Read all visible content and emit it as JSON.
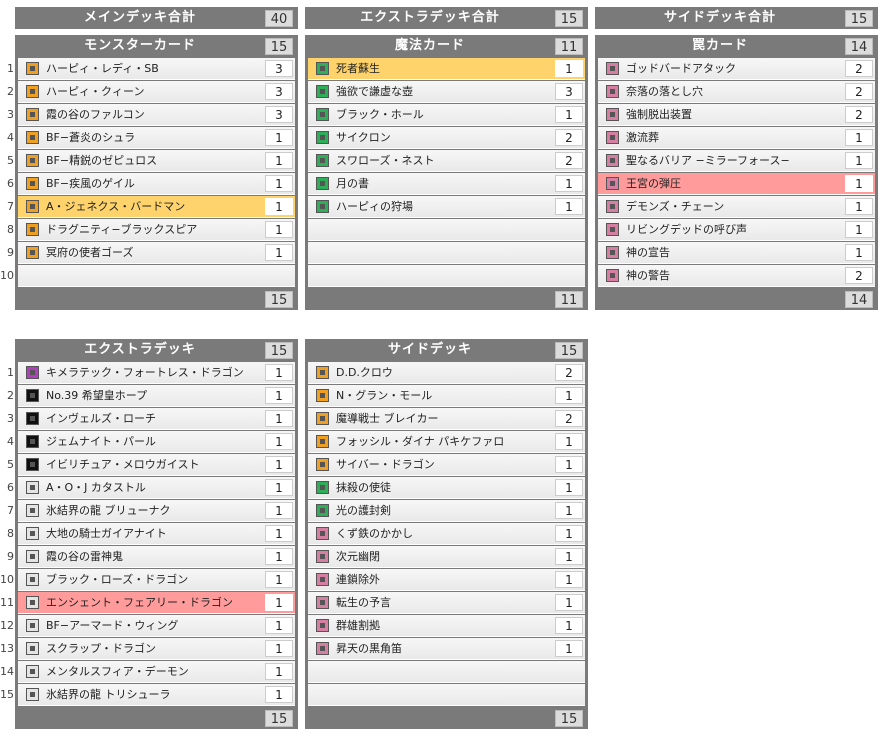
{
  "summary": [
    {
      "title": "メインデッキ合計",
      "count": "40"
    },
    {
      "title": "エクストラデッキ合計",
      "count": "15"
    },
    {
      "title": "サイドデッキ合計",
      "count": "15"
    }
  ],
  "panels": [
    {
      "id": "monster",
      "title": "モンスターカード",
      "count": "15",
      "footer": "15",
      "rownums": true,
      "rows": [
        {
          "num": "1",
          "name": "ハーピィ・レディ・SB",
          "qty": "3",
          "icon": "orange"
        },
        {
          "num": "2",
          "name": "ハーピィ・クィーン",
          "qty": "3",
          "icon": "orange"
        },
        {
          "num": "3",
          "name": "霞の谷のファルコン",
          "qty": "3",
          "icon": "orange"
        },
        {
          "num": "4",
          "name": "BF−蒼炎のシュラ",
          "qty": "1",
          "icon": "orange"
        },
        {
          "num": "5",
          "name": "BF−精鋭のゼピュロス",
          "qty": "1",
          "icon": "orange"
        },
        {
          "num": "6",
          "name": "BF−疾風のゲイル",
          "qty": "1",
          "icon": "orange"
        },
        {
          "num": "7",
          "name": "A・ジェネクス・バードマン",
          "qty": "1",
          "icon": "orange",
          "hl": "yellow"
        },
        {
          "num": "8",
          "name": "ドラグニティ−ブラックスピア",
          "qty": "1",
          "icon": "orange"
        },
        {
          "num": "9",
          "name": "冥府の使者ゴーズ",
          "qty": "1",
          "icon": "orange"
        },
        {
          "num": "10",
          "name": "",
          "qty": "",
          "icon": ""
        }
      ]
    },
    {
      "id": "spell",
      "title": "魔法カード",
      "count": "11",
      "footer": "11",
      "rownums": false,
      "rows": [
        {
          "name": "死者蘇生",
          "qty": "1",
          "icon": "green",
          "hl": "yellow"
        },
        {
          "name": "強欲で謙虚な壺",
          "qty": "3",
          "icon": "green"
        },
        {
          "name": "ブラック・ホール",
          "qty": "1",
          "icon": "green"
        },
        {
          "name": "サイクロン",
          "qty": "2",
          "icon": "green"
        },
        {
          "name": "スワローズ・ネスト",
          "qty": "2",
          "icon": "green"
        },
        {
          "name": "月の書",
          "qty": "1",
          "icon": "green"
        },
        {
          "name": "ハーピィの狩場",
          "qty": "1",
          "icon": "green"
        },
        {
          "name": "",
          "qty": "",
          "icon": ""
        },
        {
          "name": "",
          "qty": "",
          "icon": ""
        },
        {
          "name": "",
          "qty": "",
          "icon": ""
        }
      ]
    },
    {
      "id": "trap",
      "title": "罠カード",
      "count": "14",
      "footer": "14",
      "rownums": false,
      "rows": [
        {
          "name": "ゴッドバードアタック",
          "qty": "2",
          "icon": "pink"
        },
        {
          "name": "奈落の落とし穴",
          "qty": "2",
          "icon": "pink"
        },
        {
          "name": "強制脱出装置",
          "qty": "2",
          "icon": "pink"
        },
        {
          "name": "激流葬",
          "qty": "1",
          "icon": "pink"
        },
        {
          "name": "聖なるバリア −ミラーフォース−",
          "qty": "1",
          "icon": "pink"
        },
        {
          "name": "王宮の弾圧",
          "qty": "1",
          "icon": "pink",
          "hl": "red"
        },
        {
          "name": "デモンズ・チェーン",
          "qty": "1",
          "icon": "pink"
        },
        {
          "name": "リビングデッドの呼び声",
          "qty": "1",
          "icon": "pink"
        },
        {
          "name": "神の宣告",
          "qty": "1",
          "icon": "pink"
        },
        {
          "name": "神の警告",
          "qty": "2",
          "icon": "pink"
        }
      ]
    },
    {
      "id": "extra",
      "title": "エクストラデッキ",
      "count": "15",
      "footer": "15",
      "rownums": true,
      "rows": [
        {
          "num": "1",
          "name": "キメラテック・フォートレス・ドラゴン",
          "qty": "1",
          "icon": "purple"
        },
        {
          "num": "2",
          "name": "No.39 希望皇ホープ",
          "qty": "1",
          "icon": "black"
        },
        {
          "num": "3",
          "name": "インヴェルズ・ローチ",
          "qty": "1",
          "icon": "black"
        },
        {
          "num": "4",
          "name": "ジェムナイト・パール",
          "qty": "1",
          "icon": "black"
        },
        {
          "num": "5",
          "name": "イビリチュア・メロウガイスト",
          "qty": "1",
          "icon": "black"
        },
        {
          "num": "6",
          "name": "A・O・J カタストル",
          "qty": "1",
          "icon": "white"
        },
        {
          "num": "7",
          "name": "氷結界の龍 ブリューナク",
          "qty": "1",
          "icon": "white"
        },
        {
          "num": "8",
          "name": "大地の騎士ガイアナイト",
          "qty": "1",
          "icon": "white"
        },
        {
          "num": "9",
          "name": "霞の谷の雷神鬼",
          "qty": "1",
          "icon": "white"
        },
        {
          "num": "10",
          "name": "ブラック・ローズ・ドラゴン",
          "qty": "1",
          "icon": "white"
        },
        {
          "num": "11",
          "name": "エンシェント・フェアリー・ドラゴン",
          "qty": "1",
          "icon": "white",
          "hl": "red"
        },
        {
          "num": "12",
          "name": "BF−アーマード・ウィング",
          "qty": "1",
          "icon": "white"
        },
        {
          "num": "13",
          "name": "スクラップ・ドラゴン",
          "qty": "1",
          "icon": "white"
        },
        {
          "num": "14",
          "name": "メンタルスフィア・デーモン",
          "qty": "1",
          "icon": "white"
        },
        {
          "num": "15",
          "name": "氷結界の龍 トリシューラ",
          "qty": "1",
          "icon": "white"
        }
      ]
    },
    {
      "id": "side",
      "title": "サイドデッキ",
      "count": "15",
      "footer": "15",
      "rownums": false,
      "rows": [
        {
          "name": "D.D.クロウ",
          "qty": "2",
          "icon": "orange"
        },
        {
          "name": "N・グラン・モール",
          "qty": "1",
          "icon": "orange"
        },
        {
          "name": "魔導戦士 ブレイカー",
          "qty": "2",
          "icon": "orange"
        },
        {
          "name": "フォッシル・ダイナ パキケファロ",
          "qty": "1",
          "icon": "orange"
        },
        {
          "name": "サイバー・ドラゴン",
          "qty": "1",
          "icon": "orange"
        },
        {
          "name": "抹殺の使徒",
          "qty": "1",
          "icon": "green"
        },
        {
          "name": "光の護封剣",
          "qty": "1",
          "icon": "green"
        },
        {
          "name": "くず鉄のかかし",
          "qty": "1",
          "icon": "pink"
        },
        {
          "name": "次元幽閉",
          "qty": "1",
          "icon": "pink"
        },
        {
          "name": "連鎖除外",
          "qty": "1",
          "icon": "pink"
        },
        {
          "name": "転生の予言",
          "qty": "1",
          "icon": "pink"
        },
        {
          "name": "群雄割拠",
          "qty": "1",
          "icon": "pink"
        },
        {
          "name": "昇天の黒角笛",
          "qty": "1",
          "icon": "pink"
        },
        {
          "name": "",
          "qty": "",
          "icon": ""
        },
        {
          "name": "",
          "qty": "",
          "icon": ""
        }
      ]
    }
  ]
}
